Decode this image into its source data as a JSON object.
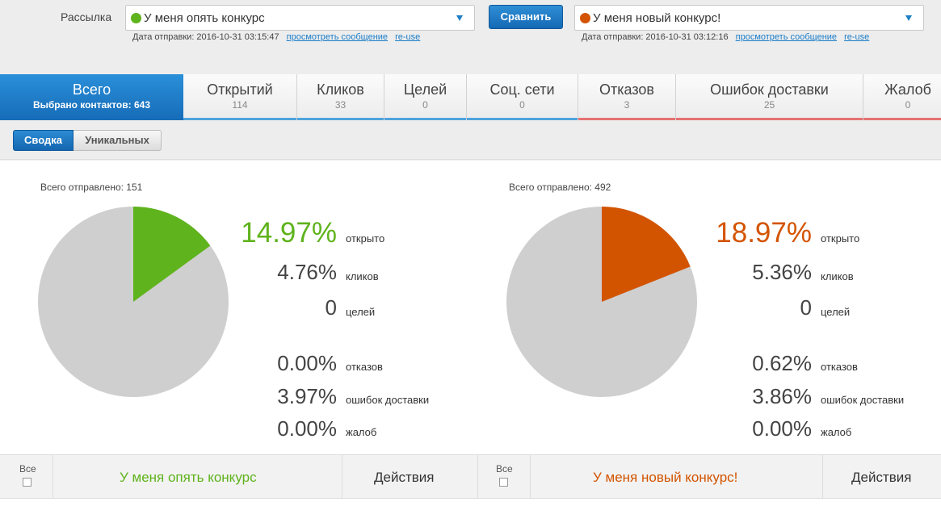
{
  "header": {
    "mailing_label": "Рассылка",
    "compare_button": "Сравнить",
    "campaign_a": {
      "name": "У меня опять конкурс",
      "color": "#5fb31c",
      "sent_date_label": "Дата отправки: 2016-10-31 03:15:47",
      "view_link": "просмотреть сообщение",
      "reuse_link": "re-use"
    },
    "campaign_b": {
      "name": "У меня новый конкурс!",
      "color": "#d35400",
      "sent_date_label": "Дата отправки: 2016-10-31 03:12:16",
      "view_link": "просмотреть сообщение",
      "reuse_link": "re-use"
    }
  },
  "tabs": [
    {
      "title": "Всего",
      "sub": "Выбрано контактов: 643",
      "active": true
    },
    {
      "title": "Открытий",
      "sub": "114"
    },
    {
      "title": "Кликов",
      "sub": "33"
    },
    {
      "title": "Целей",
      "sub": "0"
    },
    {
      "title": "Соц. сети",
      "sub": "0"
    },
    {
      "title": "Отказов",
      "sub": "3"
    },
    {
      "title": "Ошибок доставки",
      "sub": "25"
    },
    {
      "title": "Жалоб",
      "sub": "0"
    }
  ],
  "subtabs": {
    "summary": "Сводка",
    "unique": "Уникальных"
  },
  "summary_a": {
    "total_sent": "Всего отправлено: 151",
    "opened_fraction": 0.1497,
    "stats": [
      {
        "value": "14.97%",
        "label": "открыто"
      },
      {
        "value": "4.76%",
        "label": "кликов"
      },
      {
        "value": "0",
        "label": "целей"
      },
      {
        "value": "0.00%",
        "label": "отказов"
      },
      {
        "value": "3.97%",
        "label": "ошибок доставки"
      },
      {
        "value": "0.00%",
        "label": "жалоб"
      }
    ]
  },
  "summary_b": {
    "total_sent": "Всего отправлено: 492",
    "opened_fraction": 0.1897,
    "stats": [
      {
        "value": "18.97%",
        "label": "открыто"
      },
      {
        "value": "5.36%",
        "label": "кликов"
      },
      {
        "value": "0",
        "label": "целей"
      },
      {
        "value": "0.62%",
        "label": "отказов"
      },
      {
        "value": "3.86%",
        "label": "ошибок доставки"
      },
      {
        "value": "0.00%",
        "label": "жалоб"
      }
    ]
  },
  "table": {
    "all_label": "Все",
    "name_a": "У меня опять конкурс",
    "name_b": "У меня новый конкурс!",
    "actions": "Действия"
  },
  "colors": {
    "accent": "#1a7dc9",
    "green": "#5fb31c",
    "orange": "#d35400",
    "pie_rest": "#cfcfcf"
  }
}
